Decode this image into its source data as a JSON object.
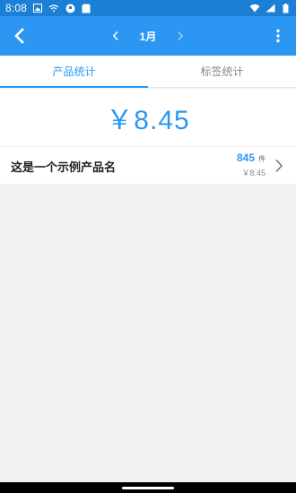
{
  "status_bar": {
    "time": "8:08",
    "icons_left": [
      "photo-icon",
      "wifi-icon",
      "app-icon",
      "clipboard-icon"
    ],
    "icons_right": [
      "wifi-icon",
      "signal-icon",
      "battery-icon"
    ]
  },
  "app_bar": {
    "month": "1月",
    "colors": {
      "background": "#2b97f2",
      "status_bar": "#1b7fd6"
    }
  },
  "tabs": [
    {
      "label": "产品统计",
      "active": true
    },
    {
      "label": "标签统计",
      "active": false
    }
  ],
  "summary": {
    "total": "￥8.45"
  },
  "products": [
    {
      "name": "这是一个示例产品名",
      "quantity": "845",
      "unit": "件",
      "amount": "￥8.45"
    }
  ],
  "colors": {
    "accent": "#2b97f2",
    "background": "#f2f2f2"
  }
}
